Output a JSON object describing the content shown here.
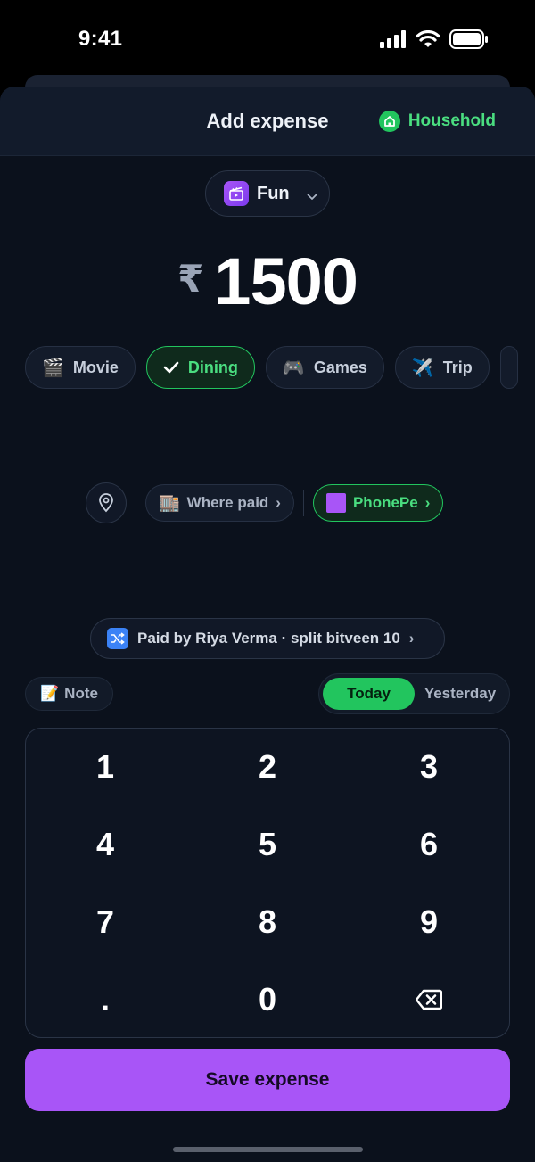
{
  "status_bar": {
    "time": "9:41"
  },
  "header": {
    "title": "Add expense",
    "group": "Household"
  },
  "category": {
    "label": "Fun"
  },
  "amount": {
    "currency": "₹",
    "value": "1500"
  },
  "subcategories": [
    {
      "emoji": "🎬",
      "label": "Movie",
      "selected": false
    },
    {
      "emoji": "",
      "label": "Dining",
      "selected": true
    },
    {
      "emoji": "🎮",
      "label": "Games",
      "selected": false
    },
    {
      "emoji": "✈️",
      "label": "Trip",
      "selected": false
    }
  ],
  "payment": {
    "where_emoji": "🏬",
    "where_label": "Where paid",
    "method_label": "PhonePe",
    "chevron": "›"
  },
  "split": {
    "text": "Paid by Riya Verma · split bitveen 10",
    "chevron": "›"
  },
  "note": {
    "emoji": "📝",
    "label": "Note"
  },
  "date": {
    "today": "Today",
    "yesterday": "Yesterday"
  },
  "keypad": {
    "keys": [
      "1",
      "2",
      "3",
      "4",
      "5",
      "6",
      "7",
      "8",
      "9",
      ".",
      "0"
    ]
  },
  "save": {
    "label": "Save expense"
  },
  "colors": {
    "accent_green": "#22c55e",
    "accent_purple": "#a855f7",
    "background": "#0b111c"
  }
}
